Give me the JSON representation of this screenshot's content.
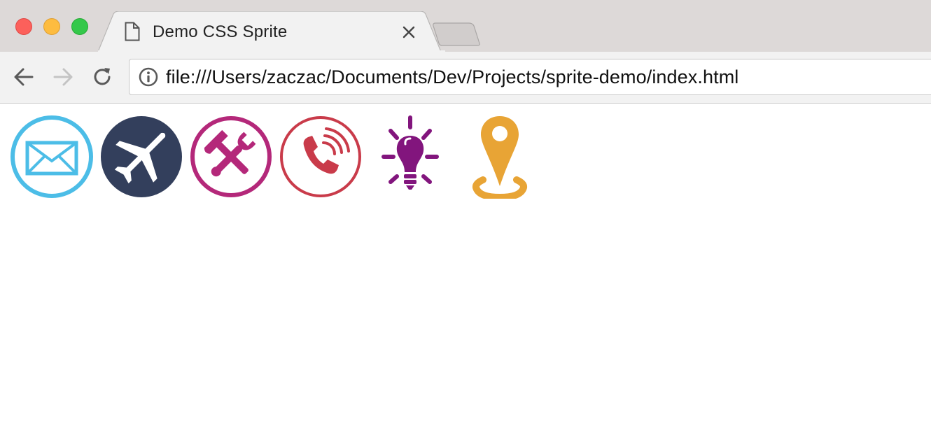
{
  "window": {
    "tab": {
      "title": "Demo CSS Sprite"
    },
    "address_bar": {
      "url": "file:///Users/zaczac/Documents/Dev/Projects/sprite-demo/index.html"
    }
  },
  "icons": {
    "tab": "document-icon",
    "close_tab": "close-icon",
    "back": "arrow-left-icon",
    "forward": "arrow-right-icon",
    "reload": "reload-icon",
    "page_info": "info-icon"
  },
  "sprites": [
    {
      "name": "mail-icon",
      "color": "#4cbde7"
    },
    {
      "name": "airplane-icon",
      "color": "#333f5c"
    },
    {
      "name": "tools-icon",
      "color": "#b4287a"
    },
    {
      "name": "phone-icon",
      "color": "#c93b4a"
    },
    {
      "name": "lightbulb-icon",
      "color": "#82157d"
    },
    {
      "name": "location-pin-icon",
      "color": "#e8a435"
    }
  ]
}
